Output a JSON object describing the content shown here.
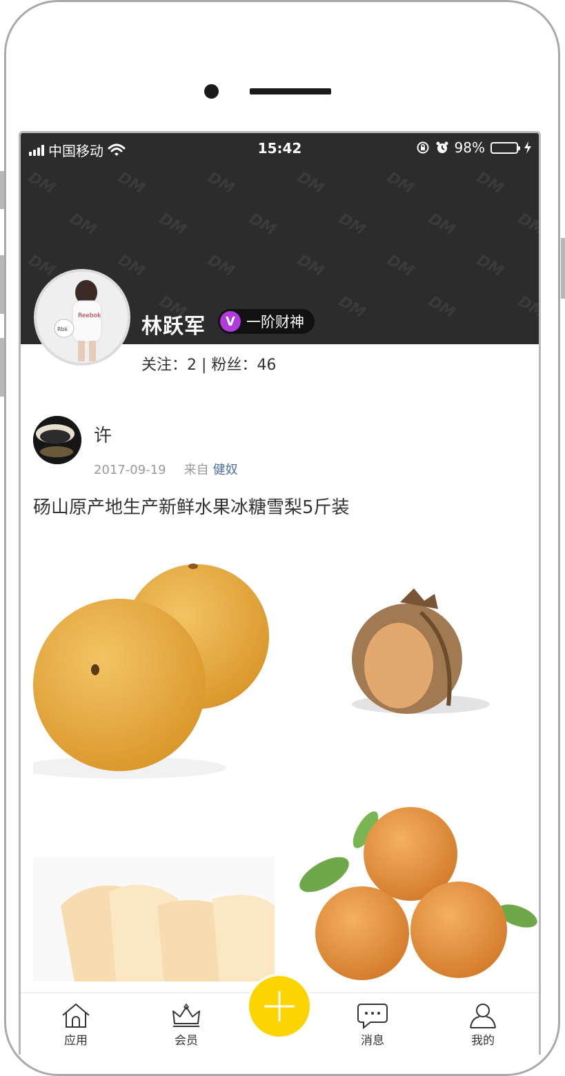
{
  "status_bar": {
    "carrier": "中国移动",
    "time": "15:42",
    "battery_percent": "98%",
    "battery_level": 0.98,
    "battery_color": "#4cd964"
  },
  "profile": {
    "name": "林跃军",
    "badge_icon_letter": "V",
    "badge_label": "一阶财神",
    "badge_color": "#b13adb",
    "follow_label": "关注：",
    "follow_count": "2",
    "separator": " | ",
    "fans_label": "粉丝：",
    "fans_count": "46"
  },
  "post": {
    "author": "许",
    "date": "2017-09-19",
    "source_prefix": "来自",
    "source_app": "健奴",
    "title": "砀山原产地生产新鲜水果冰糖雪梨5斤装",
    "images": [
      "pear-pair",
      "wrapped-pear",
      "sliced-pear",
      "pear-pile"
    ]
  },
  "tabbar": {
    "items": [
      {
        "label": "应用",
        "icon": "home-icon"
      },
      {
        "label": "会员",
        "icon": "crown-icon"
      },
      {
        "label": "",
        "icon": "plus-icon"
      },
      {
        "label": "消息",
        "icon": "message-icon"
      },
      {
        "label": "我的",
        "icon": "user-icon"
      }
    ],
    "plus_color": "#fcd500"
  }
}
